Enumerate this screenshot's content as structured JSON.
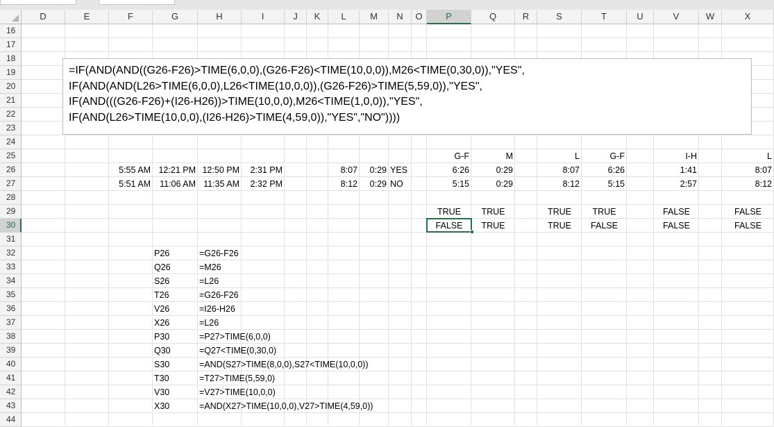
{
  "columns": [
    "D",
    "E",
    "F",
    "G",
    "H",
    "I",
    "J",
    "K",
    "L",
    "M",
    "N",
    "O",
    "P",
    "Q",
    "R",
    "S",
    "T",
    "U",
    "V",
    "W",
    "X"
  ],
  "rows": [
    "16",
    "17",
    "18",
    "19",
    "20",
    "21",
    "22",
    "23",
    "24",
    "25",
    "26",
    "27",
    "28",
    "29",
    "30",
    "31",
    "32",
    "33",
    "34",
    "35",
    "36",
    "37",
    "38",
    "39",
    "40",
    "41",
    "42",
    "43",
    "44"
  ],
  "selected_column": "P",
  "selected_row": "30",
  "textbox_lines": [
    "=IF(AND(AND((G26-F26)>TIME(6,0,0),(G26-F26)<TIME(10,0,0)),M26<TIME(0,30,0)),\"YES\",",
    "IF(AND(AND(L26>TIME(6,0,0),L26<TIME(10,0,0)),(G26-F26)>TIME(5,59,0)),\"YES\",",
    "IF(AND(((G26-F26)+(I26-H26))>TIME(10,0,0),M26<TIME(1,0,0)),\"YES\",",
    "IF(AND(L26>TIME(10,0,0),(I26-H26)>TIME(4,59,0)),\"YES\",\"NO\"))))"
  ],
  "row25": {
    "P": "G-F",
    "Q": "M",
    "S": "L",
    "T": "G-F",
    "V": "I-H",
    "X": "L"
  },
  "row26": {
    "F": "5:55 AM",
    "G": "12:21 PM",
    "H": "12:50 PM",
    "I": "2:31 PM",
    "L": "8:07",
    "M": "0:29",
    "N": "YES",
    "P": "6:26",
    "Q": "0:29",
    "S": "8:07",
    "T": "6:26",
    "V": "1:41",
    "X": "8:07"
  },
  "row27": {
    "F": "5:51 AM",
    "G": "11:06 AM",
    "H": "11:35 AM",
    "I": "2:32 PM",
    "L": "8:12",
    "M": "0:29",
    "N": "NO",
    "P": "5:15",
    "Q": "0:29",
    "S": "8:12",
    "T": "5:15",
    "V": "2:57",
    "X": "8:12"
  },
  "row29": {
    "P": "TRUE",
    "Q": "TRUE",
    "S": "TRUE",
    "T": "TRUE",
    "V": "FALSE",
    "X": "FALSE"
  },
  "row30": {
    "P": "FALSE",
    "Q": "TRUE",
    "S": "TRUE",
    "T": "FALSE",
    "V": "FALSE",
    "X": "FALSE"
  },
  "formula_list": [
    {
      "ref": "P26",
      "formula": "=G26-F26"
    },
    {
      "ref": "Q26",
      "formula": "=M26"
    },
    {
      "ref": "S26",
      "formula": "=L26"
    },
    {
      "ref": "T26",
      "formula": "=G26-F26"
    },
    {
      "ref": "V26",
      "formula": "=I26-H26"
    },
    {
      "ref": "X26",
      "formula": "=L26"
    },
    {
      "ref": "P30",
      "formula": "=P27>TIME(6,0,0)"
    },
    {
      "ref": "Q30",
      "formula": "=Q27<TIME(0,30,0)"
    },
    {
      "ref": "S30",
      "formula": "=AND(S27>TIME(8,0,0),S27<TIME(10,0,0))"
    },
    {
      "ref": "T30",
      "formula": "=T27>TIME(5,59,0)"
    },
    {
      "ref": "V30",
      "formula": "=V27>TIME(10,0,0)"
    },
    {
      "ref": "X30",
      "formula": "=AND(X27>TIME(10,0,0),V27>TIME(4,59,0))"
    }
  ],
  "colors": {
    "accent": "#217346",
    "header_bg": "#f3f3f3",
    "grid": "#e1e1e1"
  }
}
